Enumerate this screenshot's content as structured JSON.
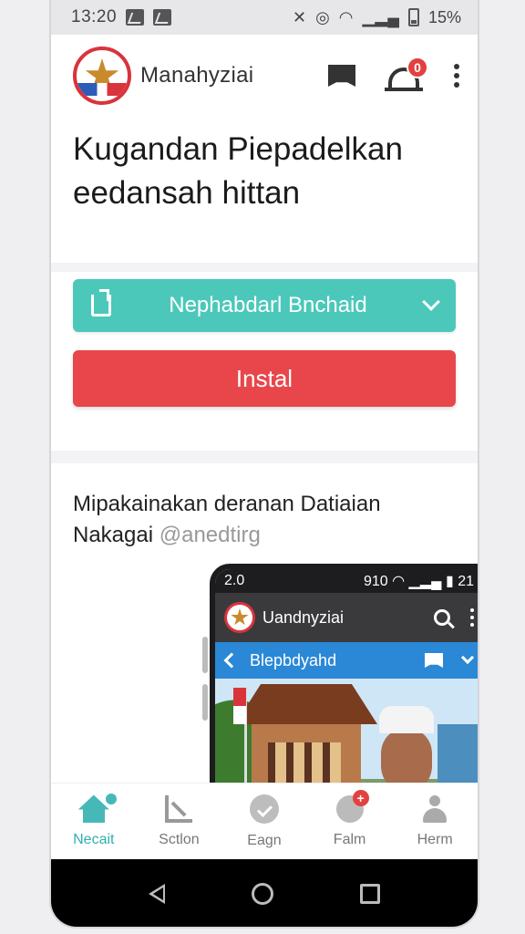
{
  "status_bar": {
    "time": "13:20",
    "battery": "15%",
    "icons": [
      "gmail-icon",
      "flipboard-icon",
      "mute-icon",
      "alarm-icon",
      "wifi-icon",
      "signal-icon",
      "battery-icon"
    ]
  },
  "app_bar": {
    "brand": "Manahyziai",
    "badge_count": "0"
  },
  "headline": {
    "line1": "Kugandan Piepadelkan",
    "line2": "eedansah hittan"
  },
  "cta": {
    "select_label": "Nephabdarl Bnchaid",
    "install_label": "Instal"
  },
  "section": {
    "title_line1": "Mipakainakan deranan Datiaian",
    "title_line2": "Nakagai",
    "handle": "@anedtirg"
  },
  "mini_phone": {
    "time": "2.0",
    "status_right": "910",
    "status_num": "21",
    "brand": "Uandnyziai",
    "nav_label": "Blepbdyahd"
  },
  "bottom_nav": {
    "items": [
      {
        "label": "Necait",
        "icon": "home-icon",
        "active": true
      },
      {
        "label": "Sctlon",
        "icon": "chart-icon",
        "active": false
      },
      {
        "label": "Eagn",
        "icon": "check-circle-icon",
        "active": false
      },
      {
        "label": "Falm",
        "icon": "chat-add-icon",
        "active": false
      },
      {
        "label": "Herm",
        "icon": "person-icon",
        "active": false
      }
    ]
  },
  "colors": {
    "accent_teal": "#4cc8ba",
    "install_red": "#e8464a",
    "nav_active": "#2fb0b0",
    "mini_nav_blue": "#2a88d6"
  }
}
